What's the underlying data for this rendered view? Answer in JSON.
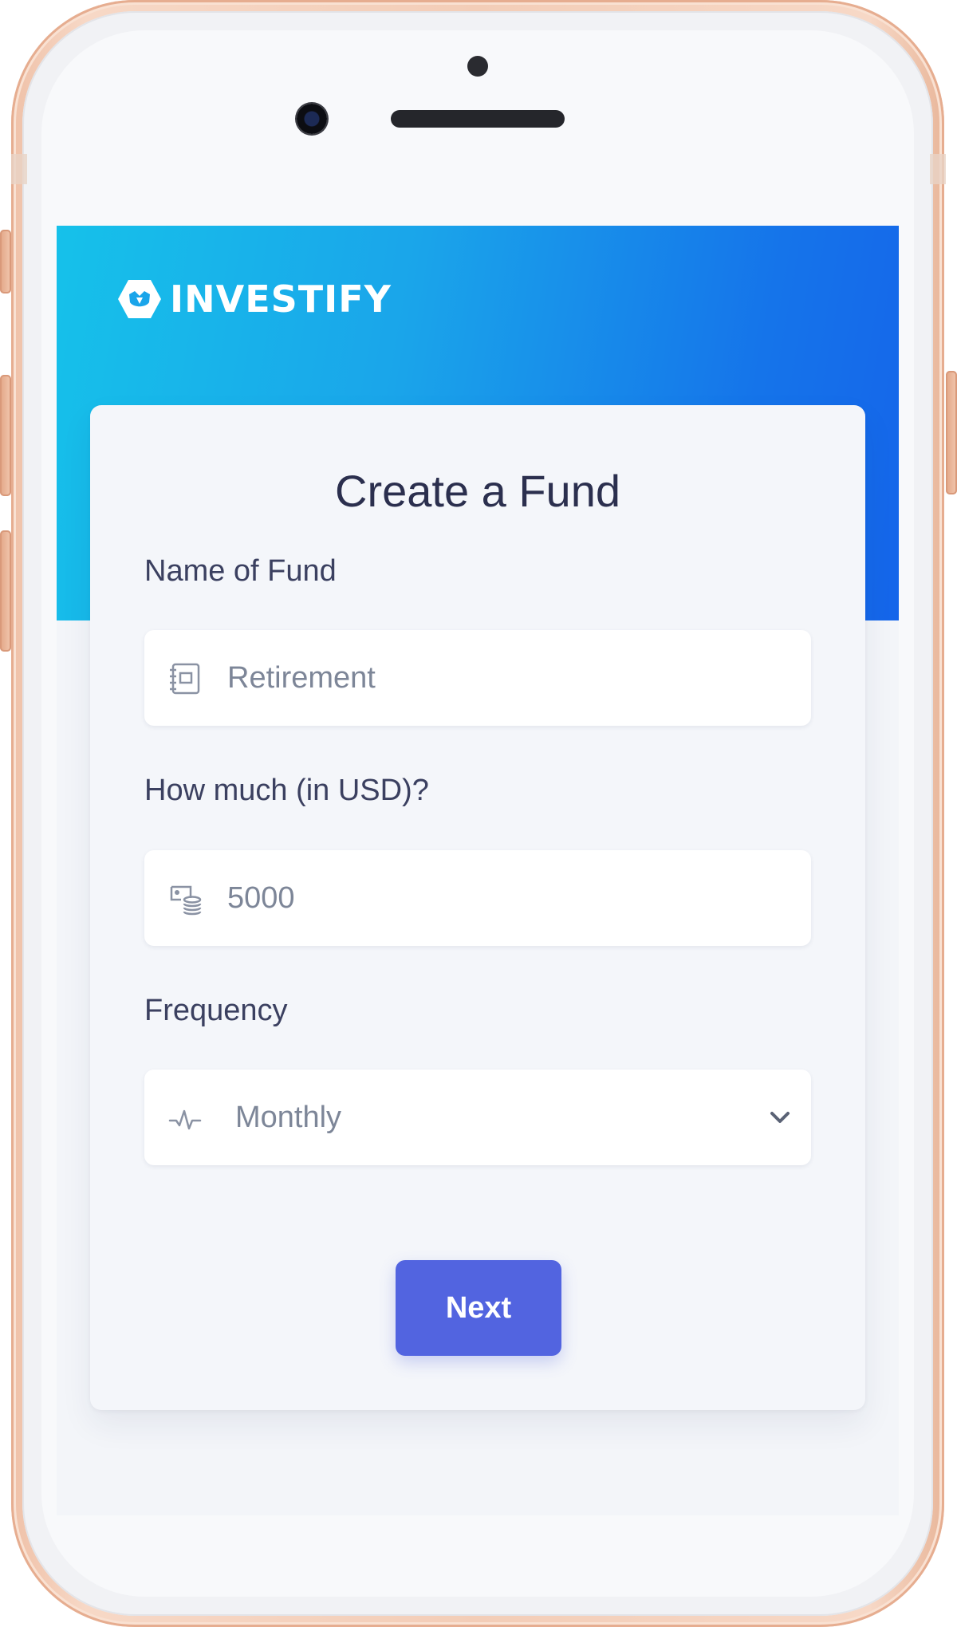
{
  "app": {
    "brand_name": "INVESTIFY",
    "brand_color": "#ffffff",
    "header_gradient": [
      "#16c1ea",
      "#1565ea"
    ]
  },
  "form": {
    "title": "Create a Fund",
    "fields": [
      {
        "label": "Name of Fund",
        "value": "Retirement",
        "icon": "notebook-icon"
      },
      {
        "label": "How much (in USD)?",
        "value": "5000",
        "icon": "money-stack-icon"
      },
      {
        "label": "Frequency",
        "value": "Monthly",
        "icon": "pulse-icon"
      }
    ],
    "submit_label": "Next",
    "submit_color": "#5264e0"
  }
}
